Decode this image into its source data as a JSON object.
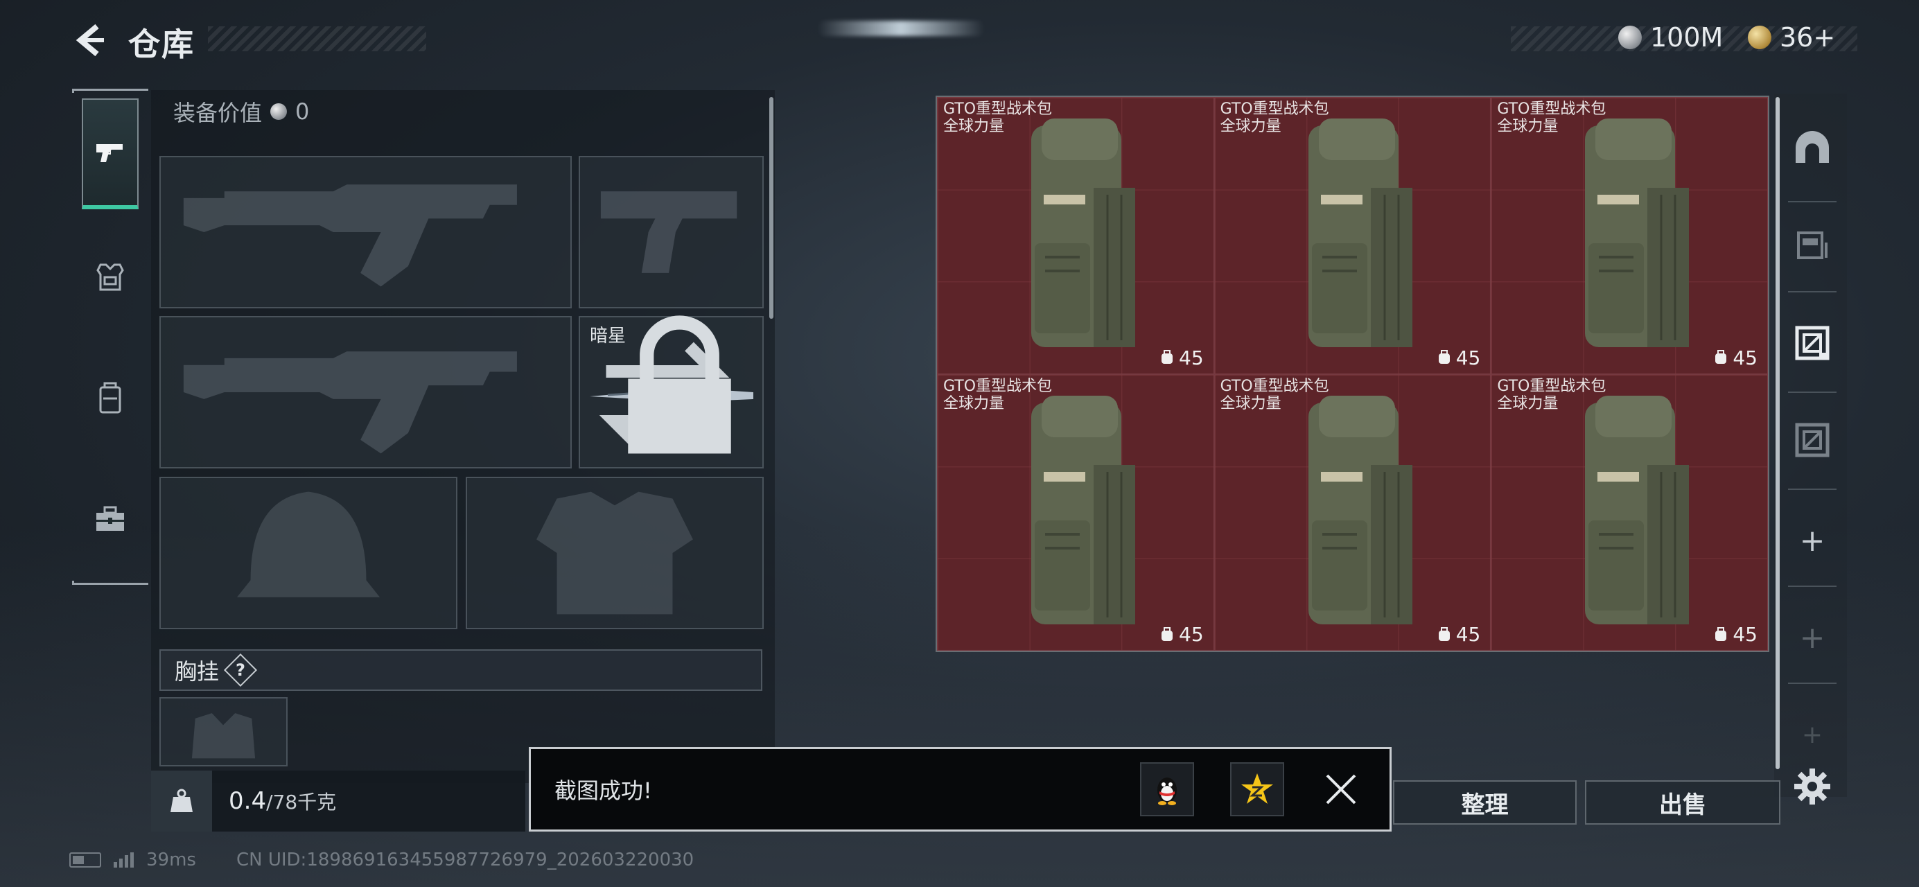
{
  "header": {
    "title": "仓库",
    "currency_silver": "100M",
    "currency_gold": "36+"
  },
  "equipment": {
    "value_label": "装备价值",
    "value_amount": "0",
    "melee_slot_name": "暗星",
    "chest_section_label": "胸挂",
    "help_mark": "?"
  },
  "weight": {
    "current": "0.4",
    "max": "/78千克"
  },
  "grid": {
    "items": [
      {
        "name": "GTO重型战术包",
        "subtitle": "全球力量",
        "level": "45"
      },
      {
        "name": "GTO重型战术包",
        "subtitle": "全球力量",
        "level": "45"
      },
      {
        "name": "GTO重型战术包",
        "subtitle": "全球力量",
        "level": "45"
      },
      {
        "name": "GTO重型战术包",
        "subtitle": "全球力量",
        "level": "45"
      },
      {
        "name": "GTO重型战术包",
        "subtitle": "全球力量",
        "level": "45"
      },
      {
        "name": "GTO重型战术包",
        "subtitle": "全球力量",
        "level": "45"
      }
    ]
  },
  "actions": {
    "sort_label": "整理",
    "sell_label": "出售"
  },
  "rail": {
    "plus": "+"
  },
  "toast": {
    "message": "截图成功!"
  },
  "status": {
    "ping": "39ms",
    "uid": "CN UID:18986916345598772697‌9_202603220030"
  },
  "colors": {
    "accent_active": "#3ec9a3",
    "grid_cell": "#5d2429",
    "panel": "#1e2a2e"
  },
  "icons": {
    "nav": [
      "pistol-icon",
      "armor-rig-icon",
      "backpack-icon",
      "toolbox-icon"
    ],
    "rail": [
      "tunnel-icon",
      "storage-icon",
      "crate-selected-icon",
      "crate-icon"
    ],
    "toast": [
      "qq-penguin-icon",
      "qzone-star-icon",
      "close-icon"
    ]
  }
}
